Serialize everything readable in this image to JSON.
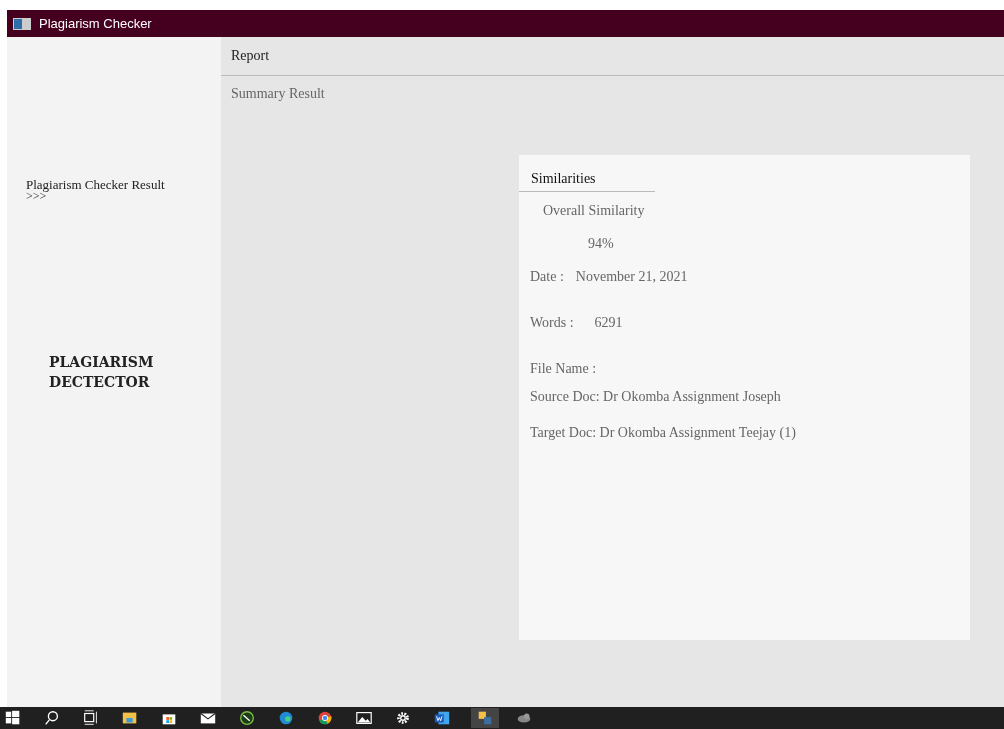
{
  "window": {
    "title": "Plagiarism Checker"
  },
  "sidebar": {
    "result_link": "Plagiarism Checker Result",
    "arrows": ">>>",
    "logo_lines": [
      "PLAGIARISM",
      "DECTECTOR"
    ]
  },
  "header": {
    "title": "Report",
    "subtitle": "Summary Result"
  },
  "card": {
    "tabs": [
      {
        "label": "Similarities",
        "selected": true
      }
    ],
    "overall_label": "Overall Similarity",
    "overall_value": "94%",
    "date_label": "Date :",
    "date_value": "November 21, 2021",
    "words_label": "Words :",
    "words_value": "6291",
    "file_label": "File Name :",
    "source": "Source Doc: Dr Okomba Assignment Joseph",
    "target": "Target Doc: Dr Okomba Assignment Teejay (1)"
  },
  "taskbar": [
    {
      "kind": "start",
      "active": false
    },
    {
      "kind": "search",
      "active": false
    },
    {
      "kind": "taskview",
      "active": false
    },
    {
      "kind": "folder",
      "active": false
    },
    {
      "kind": "store",
      "active": false
    },
    {
      "kind": "mail",
      "active": false
    },
    {
      "kind": "pen",
      "active": false
    },
    {
      "kind": "edge",
      "active": false
    },
    {
      "kind": "chrome",
      "active": false
    },
    {
      "kind": "photos",
      "active": false
    },
    {
      "kind": "gear",
      "active": false
    },
    {
      "kind": "word",
      "active": false
    },
    {
      "kind": "python",
      "active": true
    },
    {
      "kind": "blob",
      "active": false
    }
  ]
}
